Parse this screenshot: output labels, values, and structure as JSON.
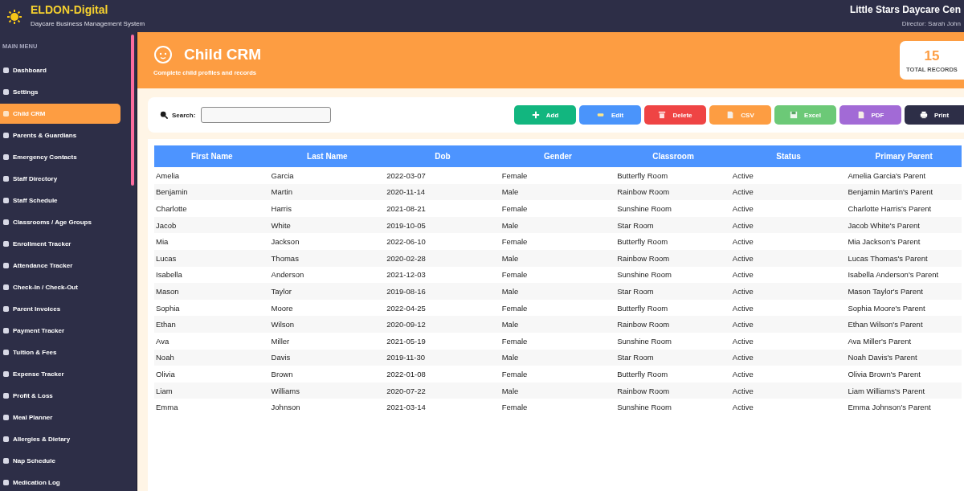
{
  "brand": {
    "name": "ELDON-Digital",
    "tagline": "Daycare Business Management System"
  },
  "center": {
    "name": "Little Stars Daycare Cen",
    "director": "Director: Sarah John"
  },
  "sidebar": {
    "heading": "MAIN MENU",
    "items": [
      {
        "label": "Dashboard",
        "selected": false
      },
      {
        "label": "Settings",
        "selected": false
      },
      {
        "label": "Child CRM",
        "selected": true
      },
      {
        "label": "Parents & Guardians",
        "selected": false
      },
      {
        "label": "Emergency Contacts",
        "selected": false
      },
      {
        "label": "Staff Directory",
        "selected": false
      },
      {
        "label": "Staff Schedule",
        "selected": false
      },
      {
        "label": "Classrooms / Age Groups",
        "selected": false
      },
      {
        "label": "Enrollment Tracker",
        "selected": false
      },
      {
        "label": "Attendance Tracker",
        "selected": false
      },
      {
        "label": "Check-In / Check-Out",
        "selected": false
      },
      {
        "label": "Parent Invoices",
        "selected": false
      },
      {
        "label": "Payment Tracker",
        "selected": false
      },
      {
        "label": "Tuition & Fees",
        "selected": false
      },
      {
        "label": "Expense Tracker",
        "selected": false
      },
      {
        "label": "Profit & Loss",
        "selected": false
      },
      {
        "label": "Meal Planner",
        "selected": false
      },
      {
        "label": "Allergies & Dietary",
        "selected": false
      },
      {
        "label": "Nap Schedule",
        "selected": false
      },
      {
        "label": "Medication Log",
        "selected": false
      }
    ]
  },
  "page": {
    "title": "Child CRM",
    "subtitle": "Complete child profiles and records",
    "total": "15",
    "total_label": "TOTAL RECORDS"
  },
  "toolbar": {
    "search_label": "Search:",
    "buttons": [
      {
        "label": "Add",
        "color": "#12b67f"
      },
      {
        "label": "Edit",
        "color": "#4a94fb"
      },
      {
        "label": "Delete",
        "color": "#ef4444"
      },
      {
        "label": "CSV",
        "color": "#fd9d42"
      },
      {
        "label": "Excel",
        "color": "#6cc977"
      },
      {
        "label": "PDF",
        "color": "#a26ad6"
      },
      {
        "label": "Print",
        "color": "#2d2e47"
      }
    ]
  },
  "table": {
    "columns": [
      "First Name",
      "Last Name",
      "Dob",
      "Gender",
      "Classroom",
      "Status",
      "Primary Parent"
    ],
    "rows": [
      [
        "Amelia",
        "Garcia",
        "2022-03-07",
        "Female",
        "Butterfly Room",
        "Active",
        "Amelia Garcia's Parent"
      ],
      [
        "Benjamin",
        "Martin",
        "2020-11-14",
        "Male",
        "Rainbow Room",
        "Active",
        "Benjamin Martin's Parent"
      ],
      [
        "Charlotte",
        "Harris",
        "2021-08-21",
        "Female",
        "Sunshine Room",
        "Active",
        "Charlotte Harris's Parent"
      ],
      [
        "Jacob",
        "White",
        "2019-10-05",
        "Male",
        "Star Room",
        "Active",
        "Jacob White's Parent"
      ],
      [
        "Mia",
        "Jackson",
        "2022-06-10",
        "Female",
        "Butterfly Room",
        "Active",
        "Mia Jackson's Parent"
      ],
      [
        "Lucas",
        "Thomas",
        "2020-02-28",
        "Male",
        "Rainbow Room",
        "Active",
        "Lucas Thomas's Parent"
      ],
      [
        "Isabella",
        "Anderson",
        "2021-12-03",
        "Female",
        "Sunshine Room",
        "Active",
        "Isabella Anderson's Parent"
      ],
      [
        "Mason",
        "Taylor",
        "2019-08-16",
        "Male",
        "Star Room",
        "Active",
        "Mason Taylor's Parent"
      ],
      [
        "Sophia",
        "Moore",
        "2022-04-25",
        "Female",
        "Butterfly Room",
        "Active",
        "Sophia Moore's Parent"
      ],
      [
        "Ethan",
        "Wilson",
        "2020-09-12",
        "Male",
        "Rainbow Room",
        "Active",
        "Ethan Wilson's Parent"
      ],
      [
        "Ava",
        "Miller",
        "2021-05-19",
        "Female",
        "Sunshine Room",
        "Active",
        "Ava Miller's Parent"
      ],
      [
        "Noah",
        "Davis",
        "2019-11-30",
        "Male",
        "Star Room",
        "Active",
        "Noah Davis's Parent"
      ],
      [
        "Olivia",
        "Brown",
        "2022-01-08",
        "Female",
        "Butterfly Room",
        "Active",
        "Olivia Brown's Parent"
      ],
      [
        "Liam",
        "Williams",
        "2020-07-22",
        "Male",
        "Rainbow Room",
        "Active",
        "Liam Williams's Parent"
      ],
      [
        "Emma",
        "Johnson",
        "2021-03-14",
        "Female",
        "Sunshine Room",
        "Active",
        "Emma Johnson's Parent"
      ]
    ]
  }
}
